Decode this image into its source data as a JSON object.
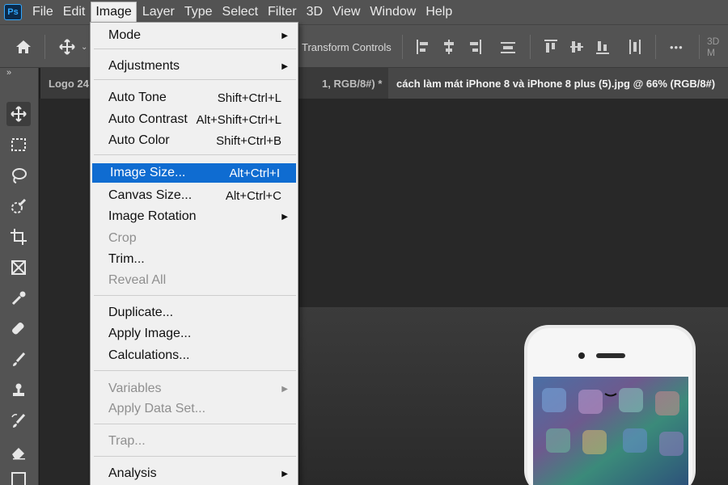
{
  "app": {
    "logo": "Ps"
  },
  "menubar": {
    "items": [
      "File",
      "Edit",
      "Image",
      "Layer",
      "Type",
      "Select",
      "Filter",
      "3D",
      "View",
      "Window",
      "Help"
    ]
  },
  "options": {
    "transform_controls": "Transform Controls",
    "more": "•••",
    "mode3d": "3D M"
  },
  "toolbar": {
    "chevron": "»"
  },
  "tabs": [
    {
      "label": "Logo 24"
    },
    {
      "label": "1, RGB/8#) *",
      "close": "×"
    },
    {
      "label": "cách làm mát iPhone 8 và iPhone 8 plus (5).jpg @ 66% (RGB/8#)"
    }
  ],
  "image_menu": {
    "items": [
      {
        "label": "Mode",
        "shortcut": "",
        "submenu": true,
        "disabled": false
      },
      {
        "label": "Adjustments",
        "shortcut": "",
        "submenu": true,
        "disabled": false
      },
      {
        "label": "Auto Tone",
        "shortcut": "Shift+Ctrl+L",
        "submenu": false,
        "disabled": false
      },
      {
        "label": "Auto Contrast",
        "shortcut": "Alt+Shift+Ctrl+L",
        "submenu": false,
        "disabled": false
      },
      {
        "label": "Auto Color",
        "shortcut": "Shift+Ctrl+B",
        "submenu": false,
        "disabled": false
      },
      {
        "label": "Image Size...",
        "shortcut": "Alt+Ctrl+I",
        "submenu": false,
        "disabled": false,
        "highlighted": true
      },
      {
        "label": "Canvas Size...",
        "shortcut": "Alt+Ctrl+C",
        "submenu": false,
        "disabled": false
      },
      {
        "label": "Image Rotation",
        "shortcut": "",
        "submenu": true,
        "disabled": false
      },
      {
        "label": "Crop",
        "shortcut": "",
        "submenu": false,
        "disabled": true
      },
      {
        "label": "Trim...",
        "shortcut": "",
        "submenu": false,
        "disabled": false
      },
      {
        "label": "Reveal All",
        "shortcut": "",
        "submenu": false,
        "disabled": true
      },
      {
        "label": "Duplicate...",
        "shortcut": "",
        "submenu": false,
        "disabled": false
      },
      {
        "label": "Apply Image...",
        "shortcut": "",
        "submenu": false,
        "disabled": false
      },
      {
        "label": "Calculations...",
        "shortcut": "",
        "submenu": false,
        "disabled": false
      },
      {
        "label": "Variables",
        "shortcut": "",
        "submenu": true,
        "disabled": true
      },
      {
        "label": "Apply Data Set...",
        "shortcut": "",
        "submenu": false,
        "disabled": true
      },
      {
        "label": "Trap...",
        "shortcut": "",
        "submenu": false,
        "disabled": true
      },
      {
        "label": "Analysis",
        "shortcut": "",
        "submenu": true,
        "disabled": false
      }
    ]
  },
  "colors": {
    "accent": "#0f6cd1",
    "chrome": "#535353",
    "canvas": "#282828",
    "menu_bg": "#f0f0f0"
  }
}
